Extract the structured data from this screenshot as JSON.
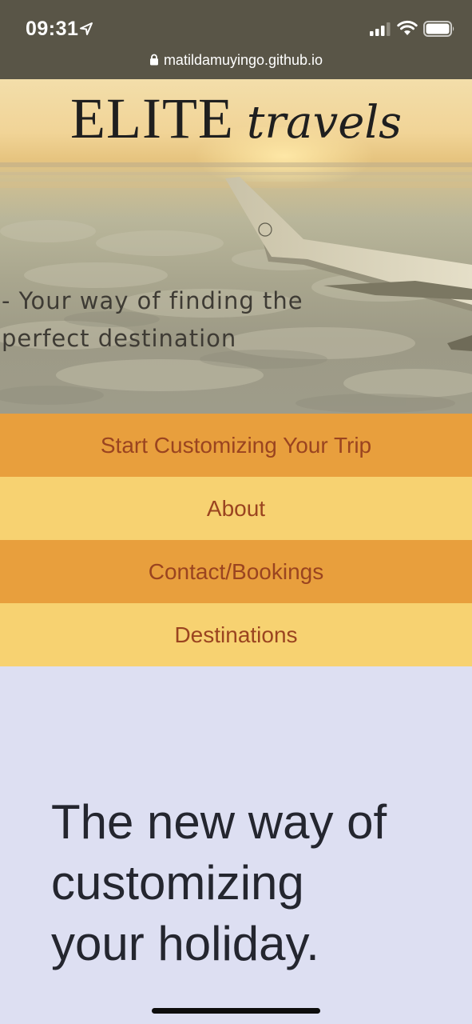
{
  "status_bar": {
    "time": "09:31",
    "url": "matildamuyingo.github.io"
  },
  "hero": {
    "logo_primary": "ELITE",
    "logo_secondary": "travels",
    "tagline_line1": "- Your way of finding the",
    "tagline_line2": "perfect destination"
  },
  "nav": {
    "items": [
      {
        "label": "Start Customizing Your Trip"
      },
      {
        "label": "About"
      },
      {
        "label": "Contact/Bookings"
      },
      {
        "label": "Destinations"
      }
    ]
  },
  "main": {
    "headline_line1": "The new way of",
    "headline_line2": "customizing",
    "headline_line3": "your holiday."
  },
  "colors": {
    "status_bar_bg": "#595547",
    "nav_dark": "#e89f3d",
    "nav_light": "#f7d271",
    "nav_text": "#9a4420",
    "page_bg": "#dddff2",
    "headline_text": "#24262f"
  }
}
